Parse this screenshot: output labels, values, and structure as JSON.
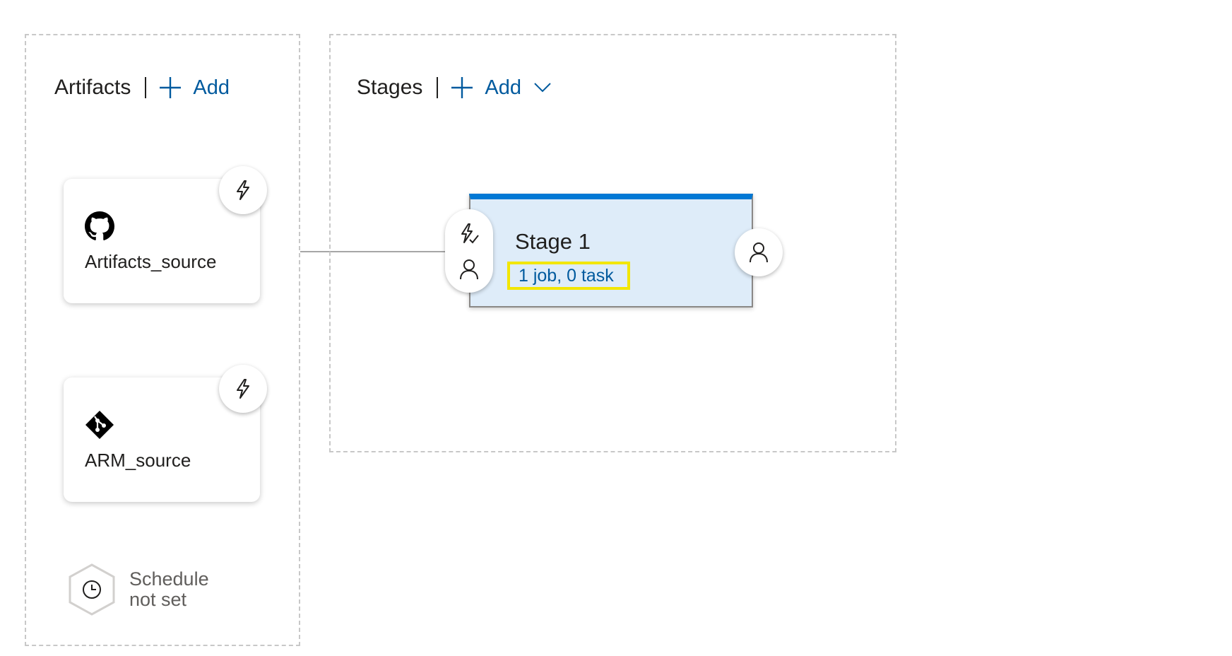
{
  "artifacts": {
    "title": "Artifacts",
    "add_label": "Add",
    "items": [
      {
        "label": "Artifacts_source",
        "icon": "github-icon",
        "trigger_icon": "lightning-icon"
      },
      {
        "label": "ARM_source",
        "icon": "git-icon",
        "trigger_icon": "lightning-icon"
      }
    ],
    "schedule": {
      "icon": "clock-icon",
      "line1": "Schedule",
      "line2": "not set"
    }
  },
  "stages": {
    "title": "Stages",
    "add_label": "Add",
    "dropdown_icon": "chevron-down-icon",
    "items": [
      {
        "name": "Stage 1",
        "summary": "1 job, 0 task",
        "pre_deployment_icons": [
          "lightning-check-icon",
          "person-icon"
        ],
        "post_deployment_icon": "person-icon"
      }
    ]
  },
  "colors": {
    "link": "#005a9e",
    "stage_accent": "#0078d4",
    "stage_background": "#deecf9",
    "highlight": "#f2e600",
    "panel_border": "#c8c8c8"
  }
}
